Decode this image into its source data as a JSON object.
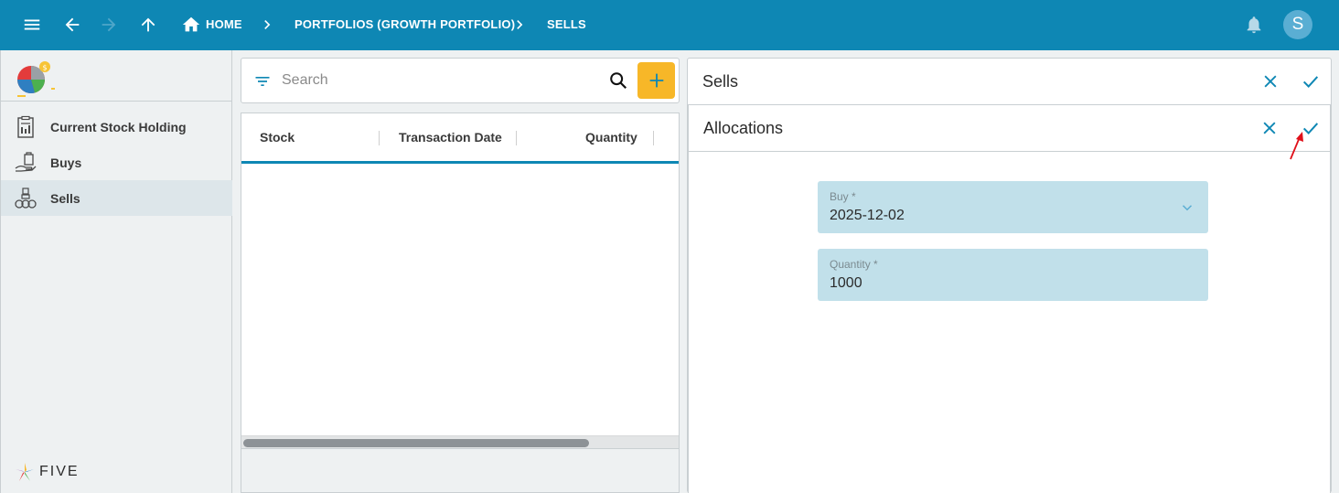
{
  "topbar": {
    "breadcrumbs": [
      {
        "label": "HOME"
      },
      {
        "label": "PORTFOLIOS (GROWTH PORTFOLIO)"
      },
      {
        "label": "SELLS"
      }
    ],
    "avatar_initial": "S",
    "bg_color": "#0e87b4"
  },
  "sidebar": {
    "items": [
      {
        "label": "Current Stock Holding",
        "icon": "document-chart-icon"
      },
      {
        "label": "Buys",
        "icon": "hand-bag-icon"
      },
      {
        "label": "Sells",
        "icon": "coins-icon",
        "active": true
      }
    ],
    "brand": "FIVE"
  },
  "list": {
    "search_placeholder": "Search",
    "columns": [
      "Stock",
      "Transaction Date",
      "Quantity"
    ],
    "rows": []
  },
  "sells_form": {
    "title": "Sells"
  },
  "allocations_form": {
    "title": "Allocations",
    "fields": [
      {
        "label": "Buy *",
        "value": "2025-12-02",
        "type": "select"
      },
      {
        "label": "Quantity *",
        "value": "1000",
        "type": "text"
      }
    ]
  },
  "colors": {
    "accent": "#0e87b4",
    "add_button": "#f7b728",
    "field_bg": "#c1e0ea",
    "annotation_arrow": "#e0101a"
  }
}
